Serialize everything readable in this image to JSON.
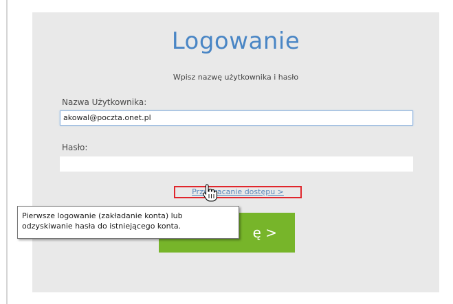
{
  "login": {
    "title": "Logowanie",
    "subtitle": "Wpisz nazwę użytkownika i hasło",
    "username_label": "Nazwa Użytkownika:",
    "username_value": "akowal@poczta.onet.pl",
    "password_label": "Hasło:",
    "password_value": "",
    "recover_link": "Przywracanie dostępu >",
    "login_button_visible_text": "ę >"
  },
  "tooltip": {
    "line1": "Pierwsze logowanie (zakładanie konta) lub",
    "line2": "odzyskiwanie hasła do istniejącego konta."
  },
  "colors": {
    "title": "#4a86c5",
    "button": "#77b52a",
    "highlight_border": "#e0262c",
    "panel": "#e9e9e9"
  },
  "icons": {
    "cursor": "hand-pointer-icon"
  }
}
